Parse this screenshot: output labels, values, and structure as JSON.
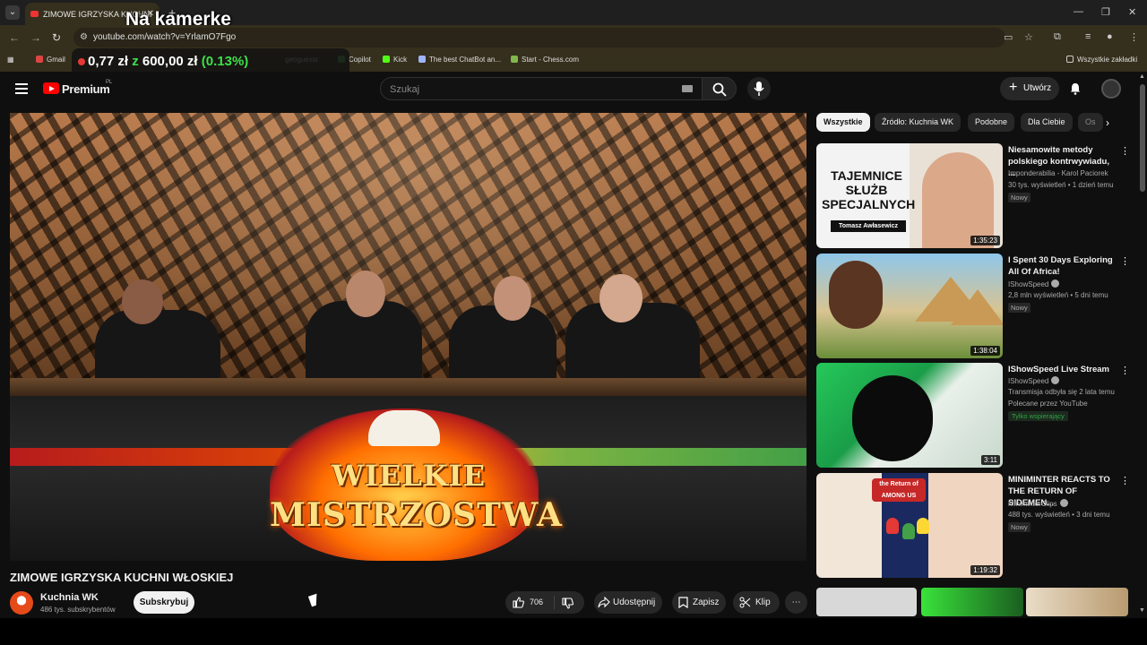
{
  "browser": {
    "tab_title": "ZIMOWE IGRZYSKA KUCHNI",
    "url": "youtube.com/watch?v=YrlamO7Fgo",
    "bookmarks": [
      "Gmail",
      "geoguessr",
      "Copilot",
      "Kick",
      "The best ChatBot an...",
      "Start - Chess.com"
    ],
    "all_bookmarks_label": "Wszystkie zakładki"
  },
  "overlay": {
    "stream_title": "Na kamerke",
    "price_prefix": "0,77 zł",
    "price_z": "z",
    "price_total": "600,00 zł",
    "price_percent": "(0.13%)"
  },
  "yt": {
    "premium_label": "Premium",
    "region": "PL",
    "search_placeholder": "Szukaj",
    "create_label": "Utwórz"
  },
  "video": {
    "title": "ZIMOWE IGRZYSKA KUCHNI WŁOSKIEJ",
    "watermark_line1": "WIELKIE",
    "watermark_line2": "MISTRZOSTWA",
    "channel": "Kuchnia WK",
    "subs": "486 tys. subskrybentów",
    "subscribe_label": "Subskrybuj",
    "likes": "706",
    "share_label": "Udostępnij",
    "save_label": "Zapisz",
    "clip_label": "Klip"
  },
  "chips": [
    "Wszystkie",
    "Źródło: Kuchnia WK",
    "Podobne",
    "Dla Ciebie",
    "Os"
  ],
  "recommendations": [
    {
      "title": "Niesamowite metody polskiego kontrwywiadu, ...",
      "channel": "Imponderabilia - Karol Paciorek",
      "meta": "30 tys. wyświetleń • 1 dzień temu",
      "badge": "Nowy",
      "duration": "1:35:23",
      "thumb_text": "TAJEMNICE SŁUŻB SPECJALNYCH",
      "thumb_name": "Tomasz Awłasewicz"
    },
    {
      "title": "I Spent 30 Days Exploring All Of Africa!",
      "channel": "IShowSpeed",
      "meta": "2,8 mln wyświetleń • 5 dni temu",
      "badge": "Nowy",
      "duration": "1:38:04"
    },
    {
      "title": "IShowSpeed Live Stream",
      "channel": "IShowSpeed",
      "meta": "Transmisja odbyła się 2 lata temu",
      "extra": "Polecane przez YouTube",
      "member": "Tylko wspierający",
      "duration": "3:11"
    },
    {
      "title": "MINIMINTER REACTS TO THE RETURN OF SIDEMEN...",
      "channel": "MiniminterClips",
      "meta": "488 tys. wyświetleń • 3 dni temu",
      "badge": "Nowy",
      "duration": "1:19:32",
      "thumb_logo": "the Return of AMONG US"
    }
  ],
  "colors": {
    "youtube_red": "#ff0000",
    "price_green": "#3ee04a",
    "background": "#0f0f0f"
  }
}
